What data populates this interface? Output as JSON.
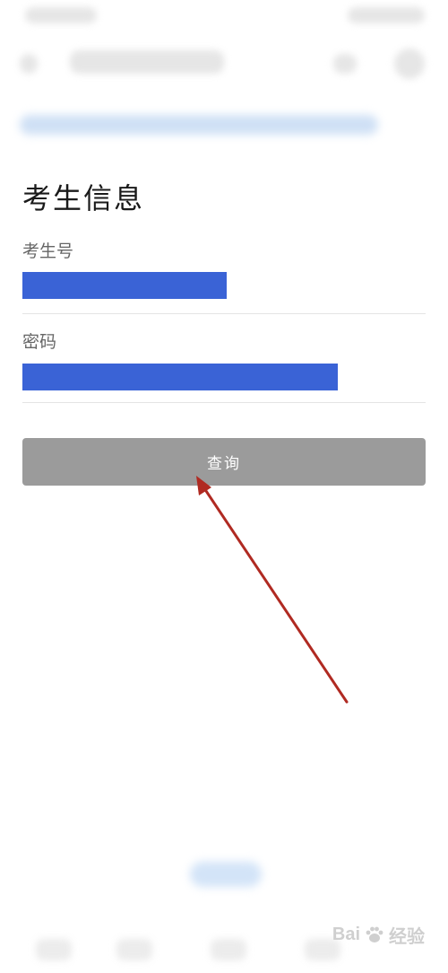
{
  "page": {
    "title": "考生信息"
  },
  "form": {
    "exam_id_label": "考生号",
    "password_label": "密码",
    "submit_label": "查询"
  },
  "watermark": {
    "text_left": "Bai",
    "text_right": "经验"
  },
  "colors": {
    "redaction_blue": "#3a63d6",
    "button_gray": "#9b9b9b",
    "arrow_red": "#b02a22"
  },
  "icons": {
    "watermark_logo": "paw-icon"
  }
}
